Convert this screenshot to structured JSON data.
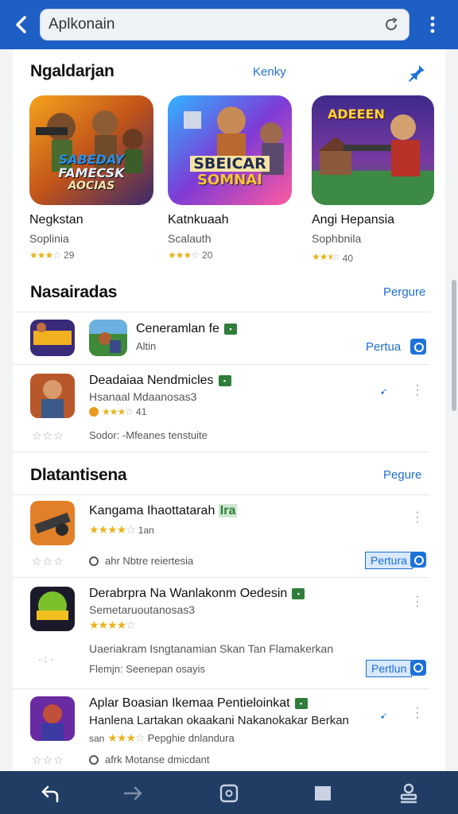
{
  "browser": {
    "url_value": "Aplkonain",
    "icons": {
      "back": "chevron-left-icon",
      "reload": "reload-icon",
      "menu": "kebab-menu-icon"
    }
  },
  "featured": {
    "title": "Ngaldarjan",
    "link": "Kenky",
    "icon": "pin-icon",
    "cards": [
      {
        "name": "Negkstan",
        "subtitle": "Soplinia",
        "rating": 3,
        "score": "29",
        "art_text": [
          "SABEDAY",
          "FAMECSK",
          "AOCIAS"
        ]
      },
      {
        "name": "Katnkuaah",
        "subtitle": "Scalauth",
        "rating": 3,
        "score": "20",
        "art_text": [
          "SBEICAR",
          "SOMNAI"
        ]
      },
      {
        "name": "Angi Hepansia",
        "subtitle": "Sophbnila",
        "rating": 2.5,
        "score": "40",
        "art_text": [
          "ADEEEN"
        ]
      }
    ]
  },
  "recommended": {
    "title": "Nasairadas",
    "link": "Pergure",
    "items": [
      {
        "title": "Ceneramlan fe",
        "subtitle": "Altin",
        "action": "Pertua"
      },
      {
        "title": "Deadaiaa Nendmicles",
        "subtitle": "Hsanaal Mdaanosas3",
        "rating": 3,
        "score": "41",
        "meta": "Sodor: -Mfeanes tenstuite",
        "action_icon": "share-arrow-icon"
      }
    ]
  },
  "latest": {
    "title": "Dlatantisena",
    "link": "Pegure",
    "items": [
      {
        "title": "Kangama Ihaottatarah",
        "badge": "Ira",
        "rating": 4,
        "score": "1an",
        "meta": "ahr Nbtre reiertesia",
        "action": "Pertura"
      },
      {
        "title": "Derabrpra Na Wanlakonm Oedesin",
        "subtitle": "Semetaruoutanosas3",
        "rating": 4,
        "meta": "Uaeriakram Isngtanamian Skan Tan Flamakerkan",
        "meta2": "Flemjn: Seenepan osayis",
        "action": "Pertlun"
      },
      {
        "title": "Aplar Boasian Ikemaa Pentieloinkat",
        "subtitle": "Hanlena Lartakan okaakani Nakanokakar Berkan",
        "rating": 3,
        "score": "san",
        "meta": "Pepghie dnlandura",
        "meta2": "afrk Motanse dmicdant",
        "action_icon": "share-arrow-icon"
      }
    ]
  },
  "bottom_nav": [
    "back-arrow-icon",
    "forward-arrow-icon",
    "tabs-icon",
    "square-icon",
    "account-icon"
  ]
}
